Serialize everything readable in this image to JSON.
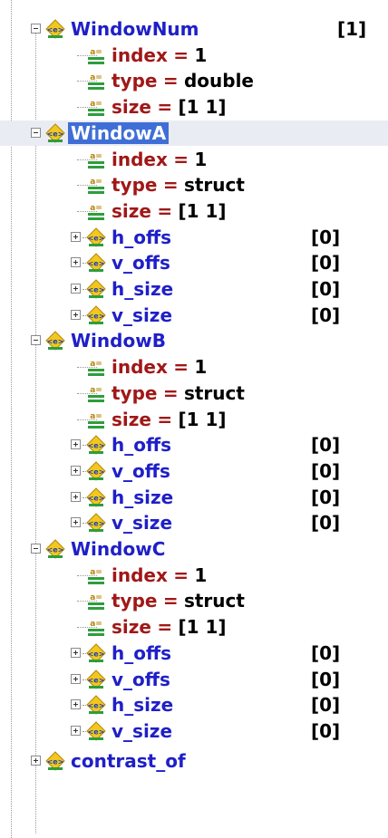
{
  "tree": [
    {
      "kind": "element",
      "level": 1,
      "name": "WindowNum",
      "value": "[1]",
      "expanded": true
    },
    {
      "kind": "attribute",
      "level": 2,
      "name": "index",
      "op": "=",
      "value": "1"
    },
    {
      "kind": "attribute",
      "level": 2,
      "name": "type",
      "op": "=",
      "value": "double"
    },
    {
      "kind": "attribute",
      "level": 2,
      "name": "size",
      "op": "=",
      "value": "[1 1]"
    },
    {
      "kind": "element",
      "level": 1,
      "name": "WindowA",
      "value": "",
      "expanded": true,
      "selected": true
    },
    {
      "kind": "attribute",
      "level": 2,
      "name": "index",
      "op": "=",
      "value": "1"
    },
    {
      "kind": "attribute",
      "level": 2,
      "name": "type",
      "op": "=",
      "value": "struct"
    },
    {
      "kind": "attribute",
      "level": 2,
      "name": "size",
      "op": "=",
      "value": "[1 1]"
    },
    {
      "kind": "element",
      "level": 2,
      "name": "h_offs",
      "value": "[0]",
      "expanded": false
    },
    {
      "kind": "element",
      "level": 2,
      "name": "v_offs",
      "value": "[0]",
      "expanded": false
    },
    {
      "kind": "element",
      "level": 2,
      "name": "h_size",
      "value": "[0]",
      "expanded": false
    },
    {
      "kind": "element",
      "level": 2,
      "name": "v_size",
      "value": "[0]",
      "expanded": false
    },
    {
      "kind": "element",
      "level": 1,
      "name": "WindowB",
      "value": "",
      "expanded": true
    },
    {
      "kind": "attribute",
      "level": 2,
      "name": "index",
      "op": "=",
      "value": "1"
    },
    {
      "kind": "attribute",
      "level": 2,
      "name": "type",
      "op": "=",
      "value": "struct"
    },
    {
      "kind": "attribute",
      "level": 2,
      "name": "size",
      "op": "=",
      "value": "[1 1]"
    },
    {
      "kind": "element",
      "level": 2,
      "name": "h_offs",
      "value": "[0]",
      "expanded": false
    },
    {
      "kind": "element",
      "level": 2,
      "name": "v_offs",
      "value": "[0]",
      "expanded": false
    },
    {
      "kind": "element",
      "level": 2,
      "name": "h_size",
      "value": "[0]",
      "expanded": false
    },
    {
      "kind": "element",
      "level": 2,
      "name": "v_size",
      "value": "[0]",
      "expanded": false
    },
    {
      "kind": "element",
      "level": 1,
      "name": "WindowC",
      "value": "",
      "expanded": true
    },
    {
      "kind": "attribute",
      "level": 2,
      "name": "index",
      "op": "=",
      "value": "1"
    },
    {
      "kind": "attribute",
      "level": 2,
      "name": "type",
      "op": "=",
      "value": "struct"
    },
    {
      "kind": "attribute",
      "level": 2,
      "name": "size",
      "op": "=",
      "value": "[1 1]"
    },
    {
      "kind": "element",
      "level": 2,
      "name": "h_offs",
      "value": "[0]",
      "expanded": false
    },
    {
      "kind": "element",
      "level": 2,
      "name": "v_offs",
      "value": "[0]",
      "expanded": false
    },
    {
      "kind": "element",
      "level": 2,
      "name": "h_size",
      "value": "[0]",
      "expanded": false
    },
    {
      "kind": "element",
      "level": 2,
      "name": "v_size",
      "value": "[0]",
      "expanded": false
    },
    {
      "kind": "element",
      "level": 1,
      "name": "contrast_of",
      "value": "",
      "expanded": false,
      "partial": true
    }
  ],
  "icons": {
    "element": "xml-element-icon",
    "attribute": "xml-attribute-icon"
  },
  "colors": {
    "element_text": "#1f1fc8",
    "attribute_text": "#a01818",
    "selection": "#3f6fd6",
    "row_highlight": "#e9edf3",
    "icon_fill": "#f2c81e",
    "icon_green": "#2e9d3c"
  }
}
